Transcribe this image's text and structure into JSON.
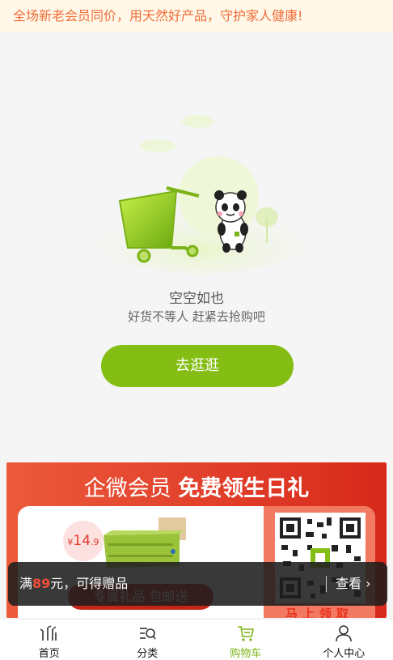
{
  "notice": {
    "text": "全场新老会员同价，用天然好产品，守护家人健康!"
  },
  "empty": {
    "title": "空空如也",
    "subtitle": "好货不等人 赶紧去抢购吧",
    "button_label": "去逛逛"
  },
  "banner": {
    "title_prefix": "企微会员",
    "title_bold": "免费领生日礼",
    "price_symbol": "¥",
    "price_main": "14",
    "price_decimal": ".9",
    "gift_label": "专属礼品 包邮送",
    "qr_caption": "马上领取"
  },
  "toast": {
    "prefix": "满",
    "amount": "89",
    "suffix": "元，可得赠品",
    "link_label": "查看"
  },
  "tabbar": {
    "items": [
      {
        "label": "首页",
        "icon": "home-bamboo-icon"
      },
      {
        "label": "分类",
        "icon": "category-search-icon"
      },
      {
        "label": "购物车",
        "icon": "cart-icon"
      },
      {
        "label": "个人中心",
        "icon": "user-icon"
      }
    ],
    "active_index": 2
  },
  "colors": {
    "brand_green": "#84bd13",
    "notice_text": "#f26d3a",
    "banner_red": "#d8291b"
  }
}
